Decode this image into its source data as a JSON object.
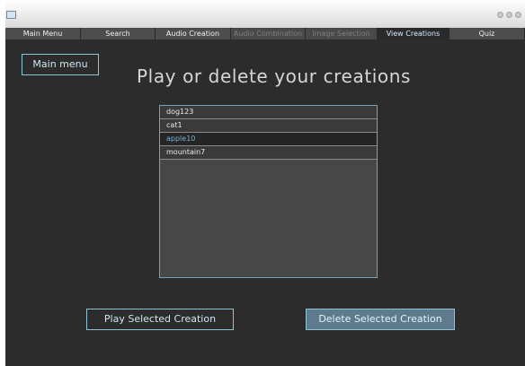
{
  "title_bar": {
    "app_icon": "window-icon",
    "controls": [
      "minimize-icon",
      "maximize-icon",
      "close-icon"
    ]
  },
  "tabs": [
    {
      "label": "Main Menu",
      "state": "normal"
    },
    {
      "label": "Search",
      "state": "normal"
    },
    {
      "label": "Audio Creation",
      "state": "normal"
    },
    {
      "label": "Audio Combination",
      "state": "disabled"
    },
    {
      "label": "Image Selection",
      "state": "disabled"
    },
    {
      "label": "View Creations",
      "state": "active"
    },
    {
      "label": "Quiz",
      "state": "normal"
    }
  ],
  "main_menu_button": "Main menu",
  "page_title": "Play or delete your creations",
  "creations": [
    {
      "name": "dog123",
      "selected": false
    },
    {
      "name": "cat1",
      "selected": false
    },
    {
      "name": "apple10",
      "selected": true
    },
    {
      "name": "mountain7",
      "selected": false
    }
  ],
  "buttons": {
    "play": "Play Selected Creation",
    "delete": "Delete Selected Creation"
  },
  "colors": {
    "background": "#2c2c2c",
    "accent_border": "#8fc3d8",
    "selected_text": "#7ab0d4",
    "delete_button_fill": "#5d7b8d"
  }
}
